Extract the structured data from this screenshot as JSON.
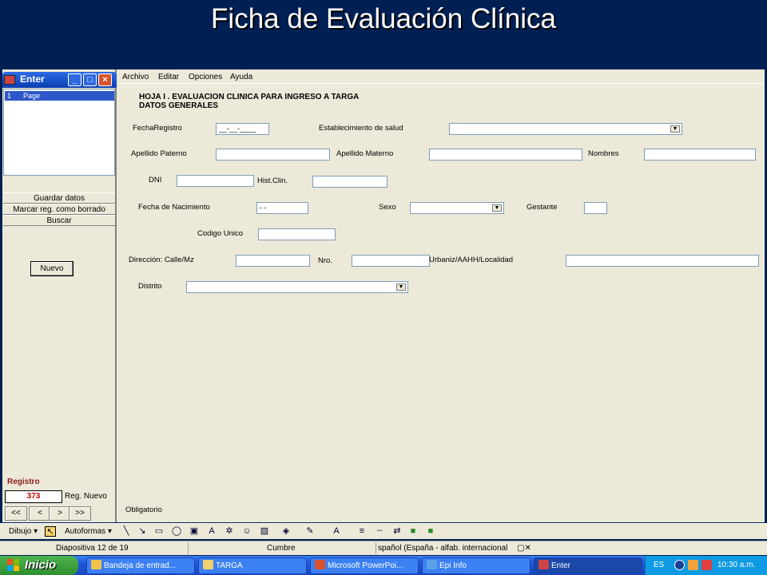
{
  "slide_title": "Ficha de Evaluación Clínica",
  "left_panel": {
    "title": "Enter",
    "pages": [
      {
        "num": "1",
        "label": "Page"
      }
    ],
    "buttons": [
      "Guardar datos",
      "Marcar reg. como borrado",
      "Buscar"
    ],
    "new_button": "Nuevo",
    "record_label": "Registro",
    "record_value": "373",
    "new_record_label": "Reg. Nuevo",
    "nav": [
      "<<",
      "<",
      ">",
      ">>"
    ]
  },
  "menu": [
    "Archivo",
    "Editar",
    "Opciones",
    "Ayuda"
  ],
  "form": {
    "header1": "HOJA I .  EVALUACION CLINICA PARA INGRESO A TARGA",
    "header2": "DATOS GENERALES",
    "fecha_registro": {
      "label": "FechaRegistro",
      "value": "__-__-____"
    },
    "establecimiento": {
      "label": "Establecimiento de salud",
      "value": ""
    },
    "apellido_paterno": {
      "label": "Apellido Paterno",
      "value": ""
    },
    "apellido_materno": {
      "label": "Apellido Materno",
      "value": ""
    },
    "nombres": {
      "label": "Nombres",
      "value": ""
    },
    "dni": {
      "label": "DNI",
      "value": ""
    },
    "hist_clin": {
      "label": "Hist.Clin.",
      "value": ""
    },
    "fecha_nacimiento": {
      "label": "Fecha de Nacimiento",
      "value": "  -  -"
    },
    "sexo": {
      "label": "Sexo",
      "value": ""
    },
    "gestante": {
      "label": "Gestante",
      "value": ""
    },
    "codigo_unico": {
      "label": "Codigo Unico",
      "value": ""
    },
    "direccion": {
      "label": "Dirección: Calle/Mz",
      "value": ""
    },
    "nro": {
      "label": "Nro.",
      "value": ""
    },
    "urbaniz": {
      "label": "Urbaniz/AAHH/Localidad",
      "value": ""
    },
    "distrito": {
      "label": "Distrito",
      "value": ""
    },
    "obligatorio": "Obligatorio"
  },
  "drawing_toolbar": {
    "dibujo": "Dibujo",
    "autoformas": "Autoformas"
  },
  "statusbar": {
    "slide": "Diapositiva 12 de 19",
    "design": "Cumbre",
    "language": "spañol (España - alfab. internacional"
  },
  "taskbar": {
    "start": "Inicio",
    "tasks": [
      "Bandeja de entrad...",
      "TARGA",
      "Microsoft PowerPoi...",
      "Epi Info",
      "Enter"
    ],
    "lang": "ES",
    "clock": "10:30 a.m."
  },
  "colors": {
    "slide_bg": "#002054",
    "taskbar": "#1f55d6",
    "start": "#2e8f2e",
    "selection": "#2c57c8"
  }
}
